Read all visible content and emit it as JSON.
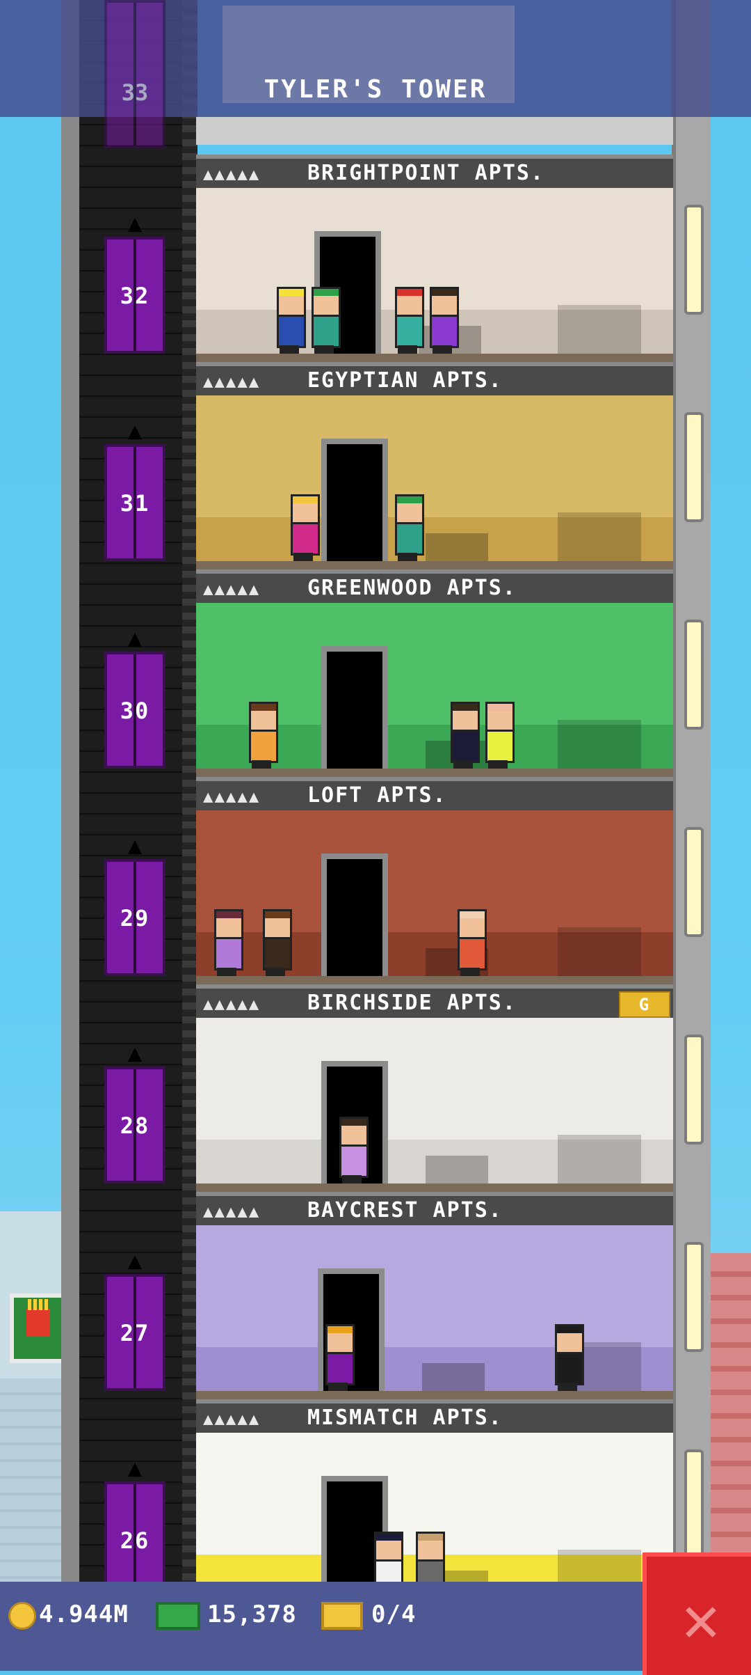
{
  "tower": {
    "title": "TYLER'S TOWER",
    "top_floor_number": "33"
  },
  "floors": [
    {
      "number": "32",
      "name": "BRIGHTPOINT APTS.",
      "stars": "▲▲▲▲▲",
      "wall": "#e9ded2",
      "accent": "#cfc4b8",
      "badge": ""
    },
    {
      "number": "31",
      "name": "EGYPTIAN APTS.",
      "stars": "▲▲▲▲▲",
      "wall": "#d8b965",
      "accent": "#c7a24b",
      "badge": ""
    },
    {
      "number": "30",
      "name": "GREENWOOD APTS.",
      "stars": "▲▲▲▲▲",
      "wall": "#4fbf68",
      "accent": "#3aa855",
      "badge": ""
    },
    {
      "number": "29",
      "name": "LOFT APTS.",
      "stars": "▲▲▲▲▲",
      "wall": "#a8523c",
      "accent": "#8e3f2c",
      "badge": ""
    },
    {
      "number": "28",
      "name": "BIRCHSIDE APTS.",
      "stars": "▲▲▲▲▲",
      "wall": "#ecebe8",
      "accent": "#d8d5d0",
      "badge": "G"
    },
    {
      "number": "27",
      "name": "BAYCREST APTS.",
      "stars": "▲▲▲▲▲",
      "wall": "#b7a9e0",
      "accent": "#9f8fd0",
      "badge": ""
    },
    {
      "number": "26",
      "name": "MISMATCH APTS.",
      "stars": "▲▲▲▲▲",
      "wall": "#f6f6f0",
      "accent": "#f3e33a",
      "badge": ""
    }
  ],
  "hud": {
    "coins": "4.944M",
    "bux": "15,378",
    "tickets": "0/4",
    "coin_icon": "coin-icon",
    "bux_icon": "bux-icon",
    "ticket_icon": "golden-ticket-icon",
    "close_icon": "close-icon"
  },
  "colors": {
    "elevator": "#7a1aa5",
    "close_button": "#d8252a",
    "hud_bar": "#4e5895"
  }
}
